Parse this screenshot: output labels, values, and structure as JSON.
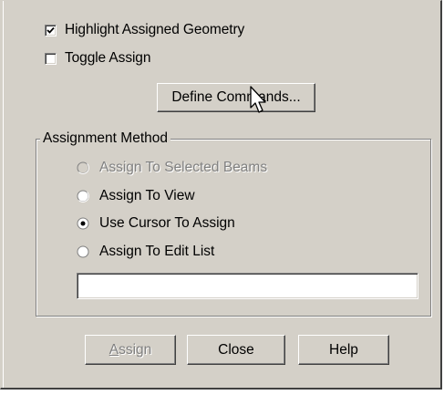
{
  "options": {
    "highlight_assigned_geometry": {
      "label": "Highlight Assigned Geometry",
      "checked": true
    },
    "toggle_assign": {
      "label": "Toggle Assign",
      "checked": false
    }
  },
  "define_commands_button": {
    "label": "Define Commands..."
  },
  "assignment_method": {
    "title": "Assignment Method",
    "options": [
      {
        "label": "Assign To Selected Beams",
        "selected": false,
        "enabled": false
      },
      {
        "label": "Assign To View",
        "selected": false,
        "enabled": true
      },
      {
        "label": "Use Cursor To Assign",
        "selected": true,
        "enabled": true
      },
      {
        "label": "Assign To Edit List",
        "selected": false,
        "enabled": true
      }
    ],
    "edit_list": {
      "value": "",
      "placeholder": ""
    }
  },
  "buttons": {
    "assign": {
      "mnemonic": "A",
      "rest": "ssign",
      "enabled": false
    },
    "close": {
      "label": "Close"
    },
    "help": {
      "label": "Help"
    }
  },
  "icons": {
    "checkmark": "checkmark-icon",
    "radio_dot": "radio-dot-icon",
    "cursor": "mouse-pointer-icon"
  }
}
